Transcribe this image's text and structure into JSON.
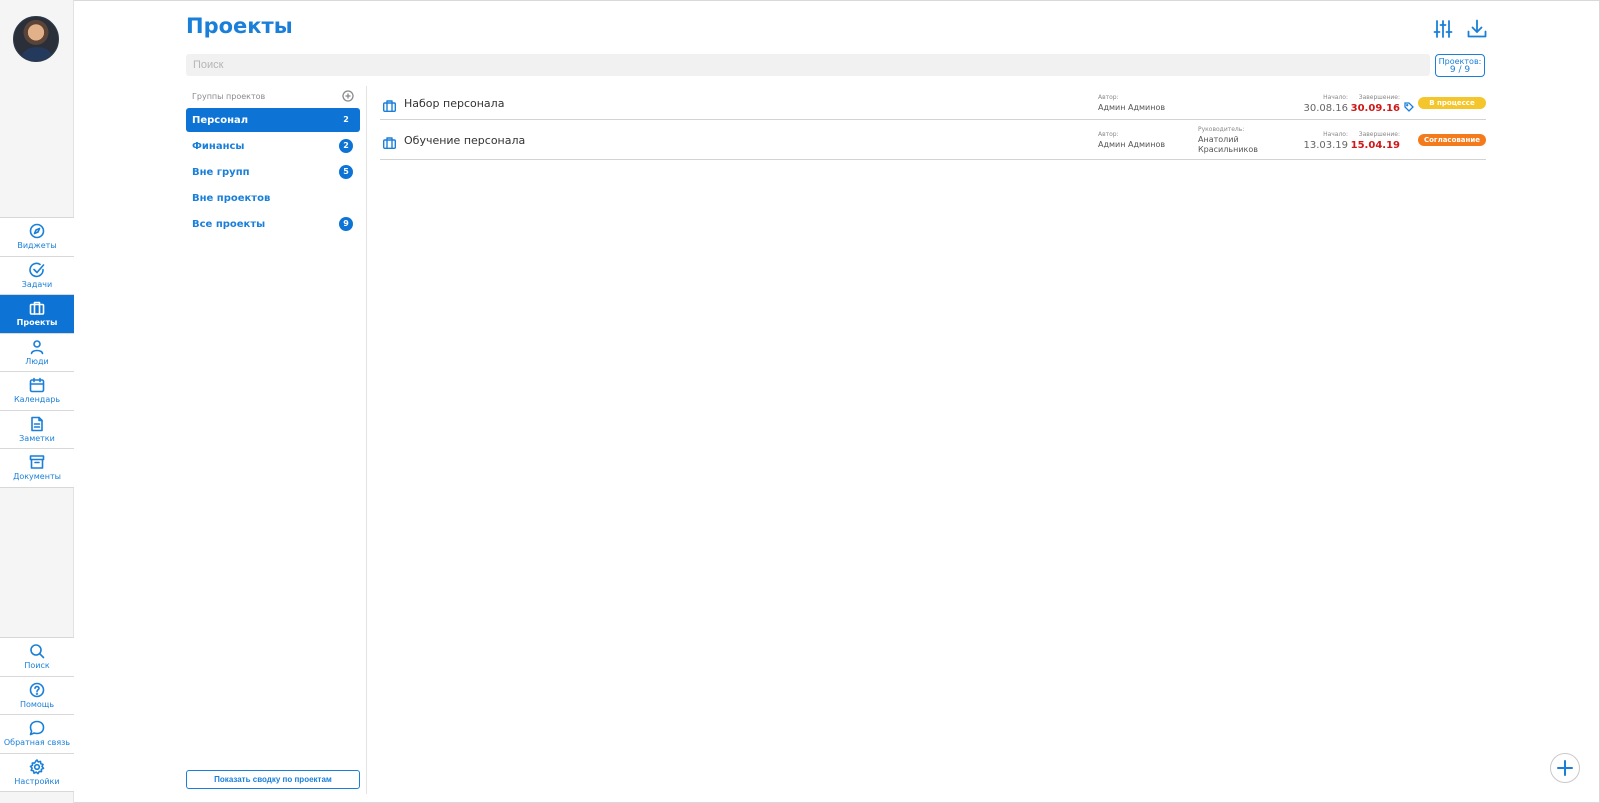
{
  "page": {
    "title": "Проекты"
  },
  "header": {
    "filter_icon": "sliders-icon",
    "download_icon": "download-icon",
    "search_placeholder": "Поиск",
    "count_label": "Проектов:",
    "count_value": "9 / 9"
  },
  "nav": {
    "top": [
      {
        "id": "widgets",
        "label": "Виджеты",
        "icon": "compass-icon",
        "active": false
      },
      {
        "id": "tasks",
        "label": "Задачи",
        "icon": "check-circle-icon",
        "active": false
      },
      {
        "id": "projects",
        "label": "Проекты",
        "icon": "briefcase-icon",
        "active": true
      },
      {
        "id": "people",
        "label": "Люди",
        "icon": "user-icon",
        "active": false
      },
      {
        "id": "calendar",
        "label": "Календарь",
        "icon": "calendar-icon",
        "active": false
      },
      {
        "id": "notes",
        "label": "Заметки",
        "icon": "document-icon",
        "active": false
      },
      {
        "id": "documents",
        "label": "Документы",
        "icon": "archive-icon",
        "active": false
      }
    ],
    "bottom": [
      {
        "id": "search",
        "label": "Поиск",
        "icon": "search-icon"
      },
      {
        "id": "help",
        "label": "Помощь",
        "icon": "help-icon"
      },
      {
        "id": "feedback",
        "label": "Обратная связь",
        "icon": "chat-bubble-icon"
      },
      {
        "id": "settings",
        "label": "Настройки",
        "icon": "gear-icon"
      }
    ]
  },
  "groups": {
    "header": "Группы проектов",
    "add_icon": "plus-circle-icon",
    "items": [
      {
        "label": "Персонал",
        "count": "2",
        "active": true
      },
      {
        "label": "Финансы",
        "count": "2",
        "active": false
      },
      {
        "label": "Вне групп",
        "count": "5",
        "active": false
      },
      {
        "label": "Вне проектов",
        "count": "",
        "active": false
      },
      {
        "label": "Все проекты",
        "count": "9",
        "active": false
      }
    ],
    "summary_button": "Показать сводку по проектам"
  },
  "projects": [
    {
      "name": "Набор персонала",
      "author_label": "Автор:",
      "author": "Админ Админов",
      "manager_label": "",
      "manager": "",
      "start_label": "Начало:",
      "start": "30.08.16",
      "end_label": "Завершение:",
      "end": "30.09.16",
      "has_tag": true,
      "status": "В процессе",
      "status_color": "#f5c62b"
    },
    {
      "name": "Обучение персонала",
      "author_label": "Автор:",
      "author": "Админ Админов",
      "manager_label": "Руководитель:",
      "manager": "Анатолий Красильников",
      "start_label": "Начало:",
      "start": "13.03.19",
      "end_label": "Завершение:",
      "end": "15.04.19",
      "has_tag": false,
      "status": "Согласование",
      "status_color": "#f47b1c"
    }
  ],
  "colors": {
    "accent": "#1a7fd9",
    "active_bg": "#0d74d6",
    "late": "#d01818"
  }
}
